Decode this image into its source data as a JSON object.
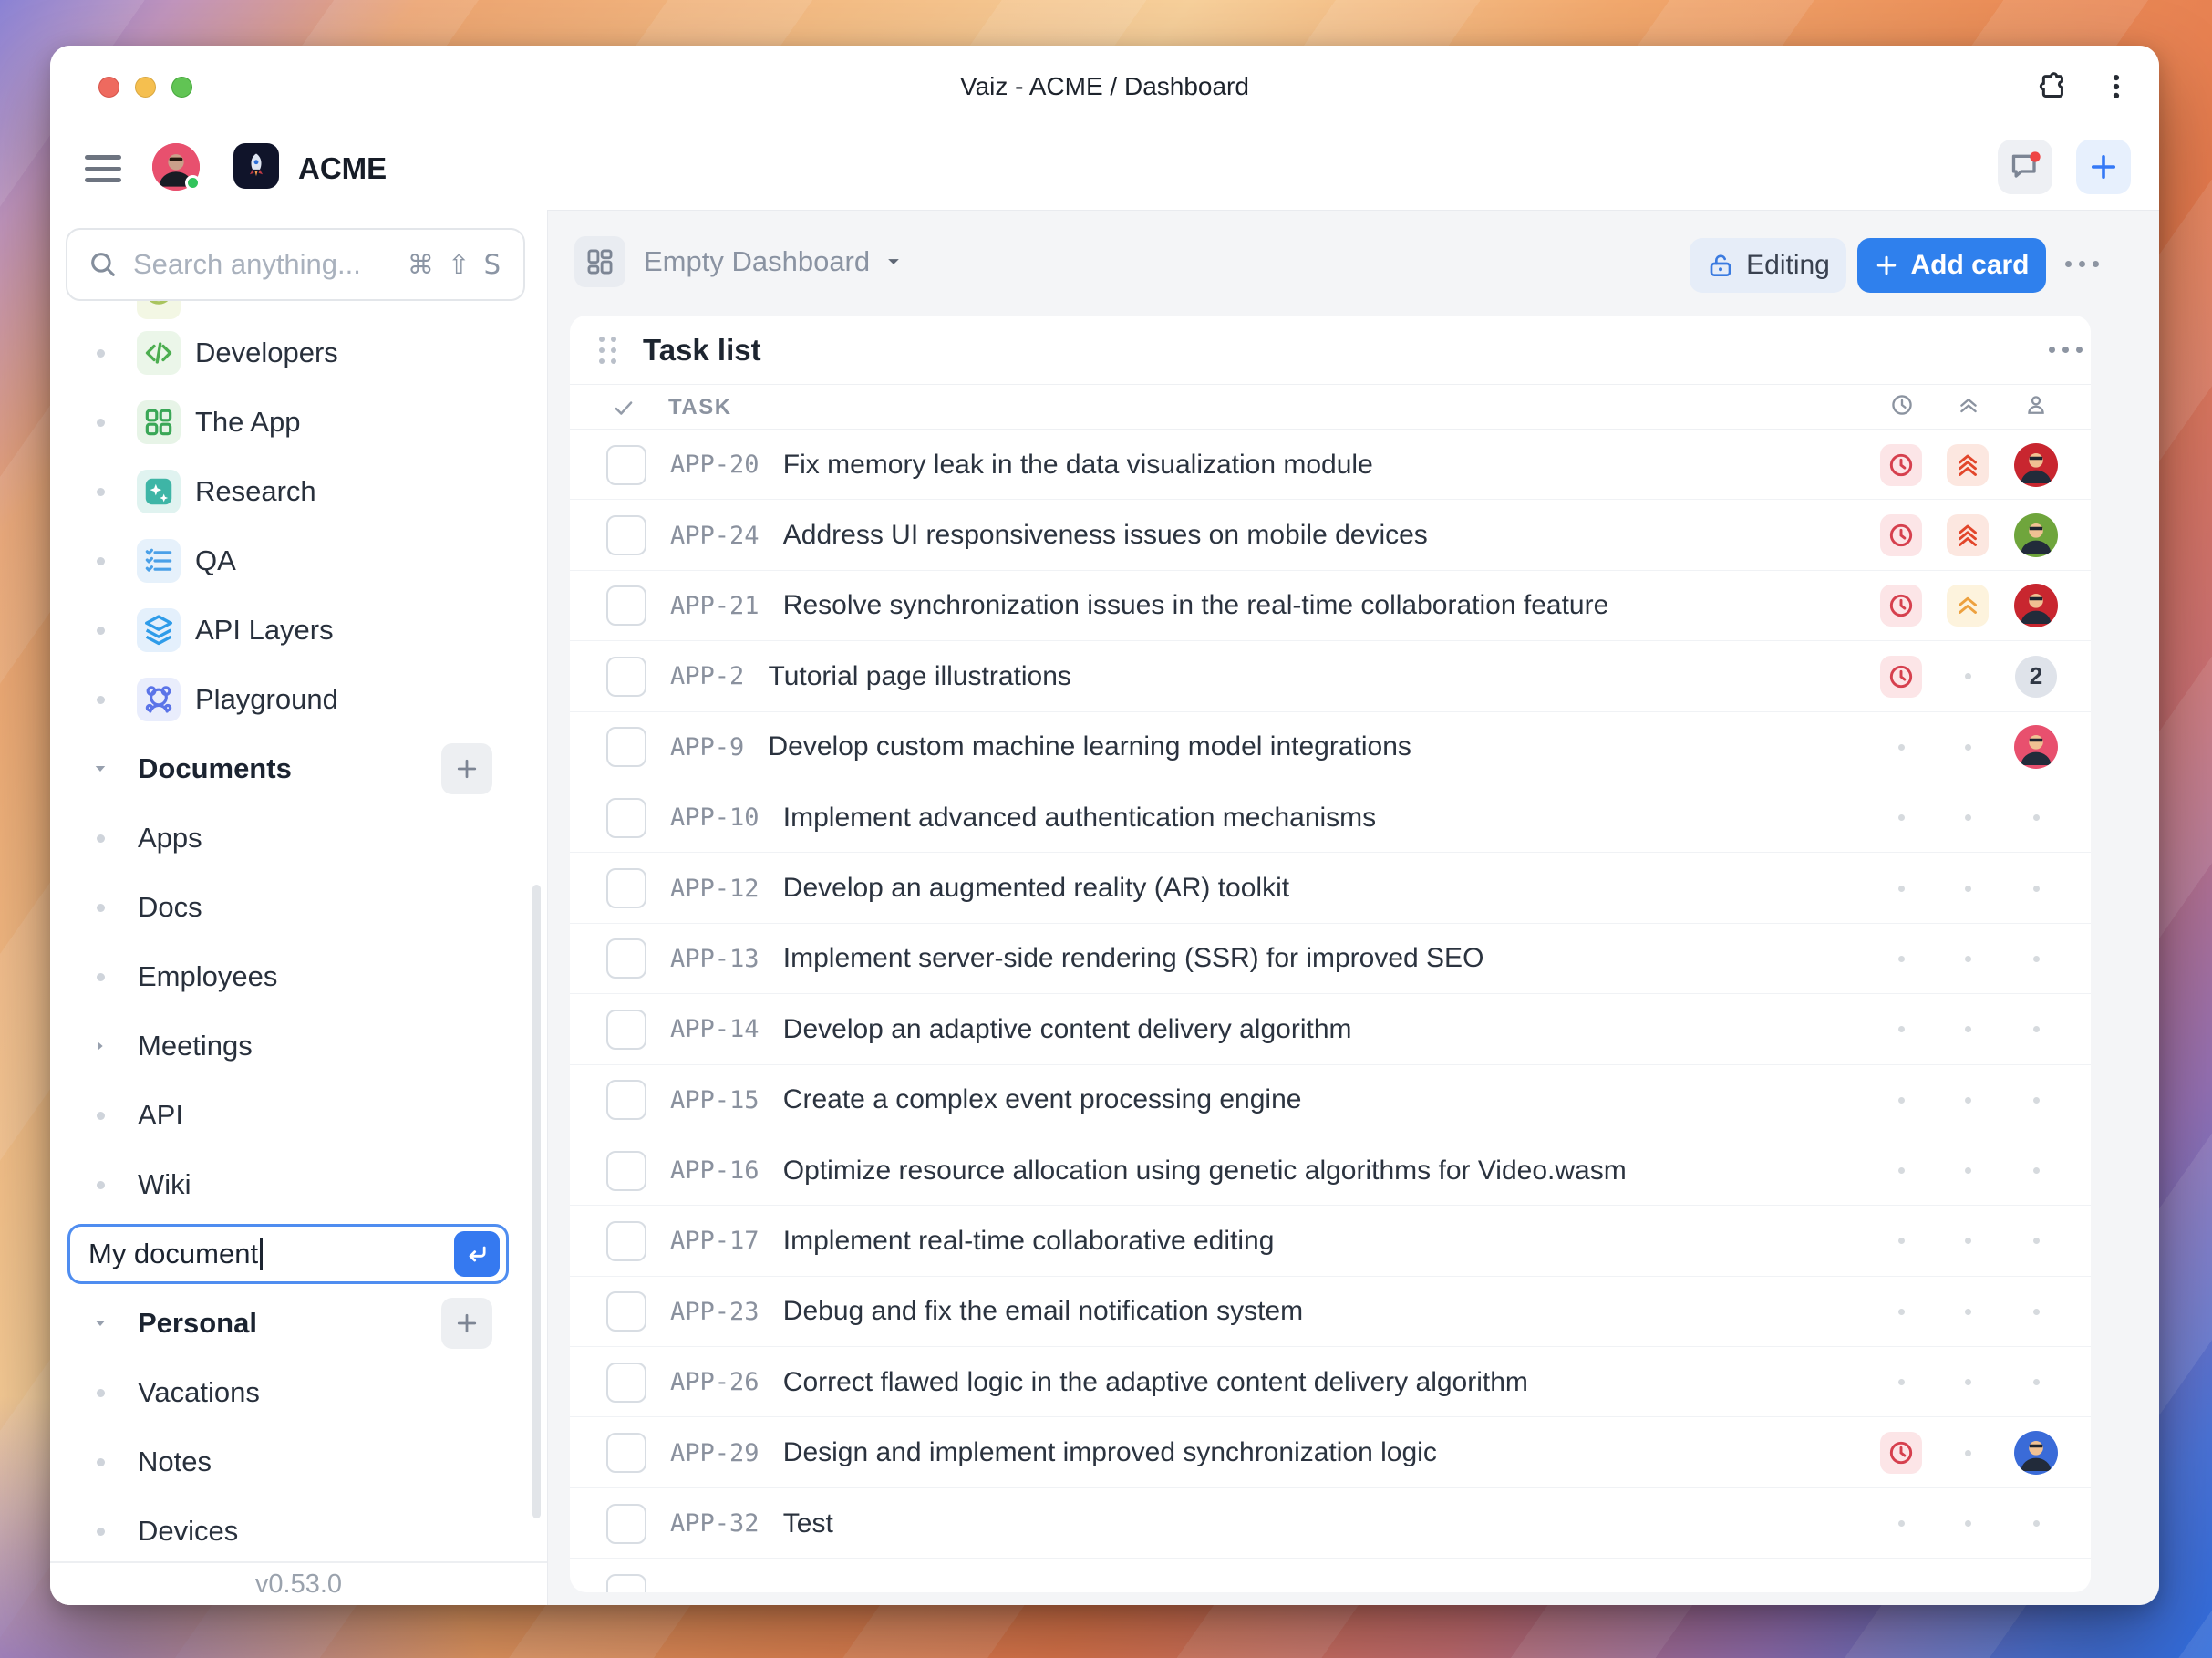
{
  "window": {
    "title": "Vaiz - ACME / Dashboard"
  },
  "header": {
    "workspace_name": "ACME"
  },
  "sidebar": {
    "search": {
      "placeholder": "Search anything...",
      "shortcut": "⌘ ⇧ S"
    },
    "items": [
      {
        "type": "item",
        "label": "Developers",
        "icon": "code-icon",
        "icon_bg": "#ebf6e9"
      },
      {
        "type": "item",
        "label": "The App",
        "icon": "grid-icon",
        "icon_bg": "#e7f4e7"
      },
      {
        "type": "item",
        "label": "Research",
        "icon": "sparkles-icon",
        "icon_bg": "#e0f3f0"
      },
      {
        "type": "item",
        "label": "QA",
        "icon": "checklist-icon",
        "icon_bg": "#e6f1fb"
      },
      {
        "type": "item",
        "label": "API Layers",
        "icon": "layers-icon",
        "icon_bg": "#e4f0fc"
      },
      {
        "type": "item",
        "label": "Playground",
        "icon": "bear-icon",
        "icon_bg": "#e9edfc"
      },
      {
        "type": "section",
        "label": "Documents"
      },
      {
        "type": "item",
        "label": "Apps"
      },
      {
        "type": "item",
        "label": "Docs"
      },
      {
        "type": "item",
        "label": "Employees"
      },
      {
        "type": "item",
        "label": "Meetings",
        "expandable": true
      },
      {
        "type": "item",
        "label": "API"
      },
      {
        "type": "item",
        "label": "Wiki"
      },
      {
        "type": "input"
      },
      {
        "type": "section",
        "label": "Personal"
      },
      {
        "type": "item",
        "label": "Vacations"
      },
      {
        "type": "item",
        "label": "Notes"
      },
      {
        "type": "item",
        "label": "Devices"
      }
    ],
    "new_document": {
      "value": "My document"
    },
    "version": "v0.53.0"
  },
  "dashboard": {
    "title": "Empty Dashboard",
    "editing_label": "Editing",
    "add_card_label": "Add card"
  },
  "task_card": {
    "title": "Task list",
    "column_task": "TASK",
    "tasks": [
      {
        "id": "APP-20",
        "title": "Fix memory leak in the data visualization module",
        "due": true,
        "priority": "urgent",
        "assignee": {
          "type": "avatar",
          "color": "red"
        }
      },
      {
        "id": "APP-24",
        "title": "Address UI responsiveness issues on mobile devices",
        "due": true,
        "priority": "urgent",
        "assignee": {
          "type": "avatar",
          "color": "green"
        }
      },
      {
        "id": "APP-21",
        "title": "Resolve synchronization issues in the real-time collaboration feature",
        "due": true,
        "priority": "high",
        "assignee": {
          "type": "avatar",
          "color": "red"
        }
      },
      {
        "id": "APP-2",
        "title": "Tutorial page illustrations",
        "due": true,
        "assignee": {
          "type": "count",
          "value": "2"
        }
      },
      {
        "id": "APP-9",
        "title": "Develop custom machine learning model integrations",
        "assignee": {
          "type": "avatar",
          "color": "pink"
        }
      },
      {
        "id": "APP-10",
        "title": "Implement advanced authentication mechanisms"
      },
      {
        "id": "APP-12",
        "title": "Develop an augmented reality (AR) toolkit"
      },
      {
        "id": "APP-13",
        "title": "Implement server-side rendering (SSR) for improved SEO"
      },
      {
        "id": "APP-14",
        "title": "Develop an adaptive content delivery algorithm"
      },
      {
        "id": "APP-15",
        "title": "Create a complex event processing engine"
      },
      {
        "id": "APP-16",
        "title": "Optimize resource allocation using genetic algorithms for Video.wasm"
      },
      {
        "id": "APP-17",
        "title": "Implement real-time collaborative editing"
      },
      {
        "id": "APP-23",
        "title": "Debug and fix the email notification system"
      },
      {
        "id": "APP-26",
        "title": "Correct flawed logic in the adaptive content delivery algorithm"
      },
      {
        "id": "APP-29",
        "title": "Design and implement improved synchronization logic",
        "due": true,
        "assignee": {
          "type": "avatar",
          "color": "blue"
        }
      },
      {
        "id": "APP-32",
        "title": "Test"
      },
      {
        "id": "",
        "title": "",
        "partial": true
      }
    ]
  },
  "colors": {
    "accent_blue": "#2f80ed",
    "due_icon": "#d6404e",
    "due_bg": "#fce5e7",
    "priority_urgent_icon": "#e2462b",
    "priority_urgent_bg": "#fce7e0",
    "priority_high_icon": "#eda13f",
    "priority_high_bg": "#fdf3dd",
    "avatar_palette": {
      "red": "#c8262f",
      "green": "#6fa53c",
      "pink": "#e8506e",
      "blue": "#3a6bd8"
    }
  }
}
